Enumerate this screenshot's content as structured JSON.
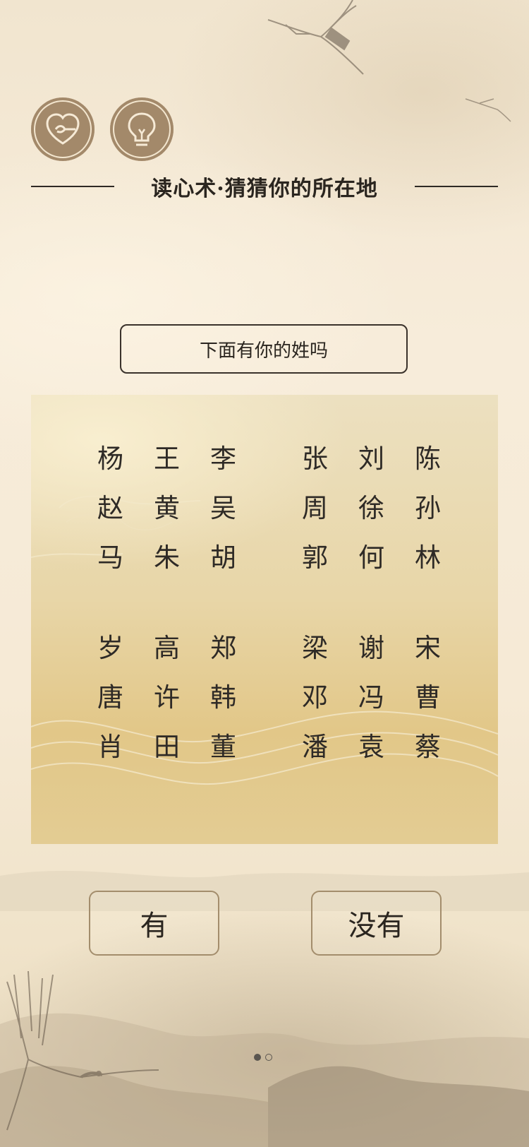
{
  "page": {
    "title": "读心术·猜猜你的所在地"
  },
  "toolbar": {
    "back_icon": "heart-back-icon",
    "hint_icon": "lightbulb-icon"
  },
  "question": {
    "text": "下面有你的姓吗"
  },
  "surname_groups": [
    {
      "names": [
        "杨",
        "王",
        "李",
        "赵",
        "黄",
        "吴",
        "马",
        "朱",
        "胡"
      ]
    },
    {
      "names": [
        "张",
        "刘",
        "陈",
        "周",
        "徐",
        "孙",
        "郭",
        "何",
        "林"
      ]
    },
    {
      "names": [
        "岁",
        "高",
        "郑",
        "唐",
        "许",
        "韩",
        "肖",
        "田",
        "董"
      ]
    },
    {
      "names": [
        "梁",
        "谢",
        "宋",
        "邓",
        "冯",
        "曹",
        "潘",
        "袁",
        "蔡"
      ]
    }
  ],
  "answers": {
    "yes_label": "有",
    "no_label": "没有"
  },
  "pagination": {
    "total": 2,
    "current": 1
  },
  "colors": {
    "button_brown": "#a3896a",
    "panel_gold": "#e2c788",
    "text_dark": "#2a251f"
  }
}
